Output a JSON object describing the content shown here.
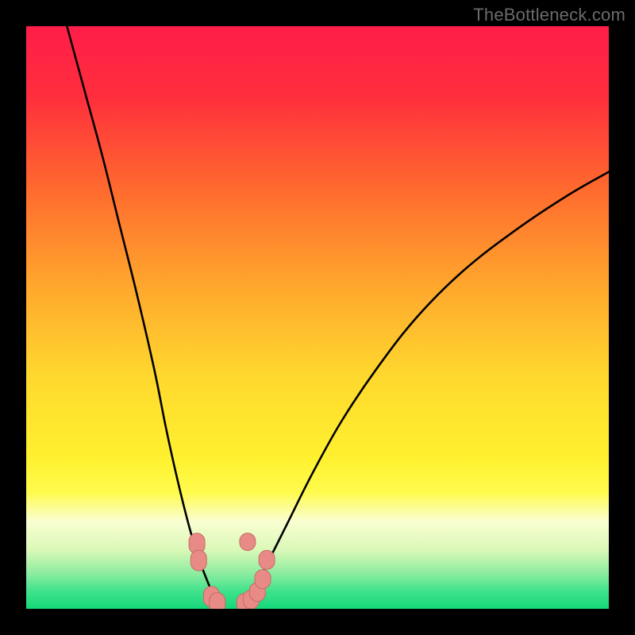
{
  "watermark": "TheBottleneck.com",
  "colors": {
    "gradient_stops": [
      {
        "offset": 0.0,
        "color": "#ff1d49"
      },
      {
        "offset": 0.12,
        "color": "#ff2e3d"
      },
      {
        "offset": 0.28,
        "color": "#ff6a2e"
      },
      {
        "offset": 0.44,
        "color": "#ffa52d"
      },
      {
        "offset": 0.6,
        "color": "#ffd82e"
      },
      {
        "offset": 0.74,
        "color": "#fff12f"
      },
      {
        "offset": 0.8,
        "color": "#fffb4d"
      },
      {
        "offset": 0.85,
        "color": "#fafed2"
      },
      {
        "offset": 0.9,
        "color": "#d9f8b7"
      },
      {
        "offset": 0.94,
        "color": "#8aec9f"
      },
      {
        "offset": 0.97,
        "color": "#3fe28c"
      },
      {
        "offset": 1.0,
        "color": "#16d87b"
      }
    ],
    "curve": "#000000",
    "markers_fill": "#e88b86",
    "markers_stroke": "#c96a64"
  },
  "chart_data": {
    "type": "line",
    "title": "",
    "xlabel": "",
    "ylabel": "",
    "xlim": [
      0,
      100
    ],
    "ylim": [
      0,
      100
    ],
    "series": [
      {
        "name": "left-arm",
        "x": [
          7,
          10,
          13,
          16,
          19,
          22,
          24,
          26,
          28,
          29.5,
          31,
          32.3,
          33.3
        ],
        "values": [
          100,
          89,
          78,
          66,
          54,
          41,
          31,
          22,
          14,
          9,
          5,
          2,
          0.5
        ]
      },
      {
        "name": "right-arm",
        "x": [
          37.3,
          38.5,
          40,
          42,
          45,
          49,
          54,
          60,
          67,
          75,
          84,
          93,
          100
        ],
        "values": [
          0.5,
          2,
          5,
          9,
          15,
          23,
          32,
          41,
          50,
          58,
          65,
          71,
          75
        ]
      }
    ],
    "markers": {
      "left_cluster": {
        "x": [
          29.3,
          29.6,
          31.8,
          32.8
        ],
        "y": [
          11.2,
          8.3,
          2.1,
          1.0
        ]
      },
      "right_cluster": {
        "x": [
          37.5,
          38.6,
          39.7,
          40.6,
          41.3
        ],
        "y": [
          1.0,
          1.6,
          2.9,
          5.1,
          8.4
        ]
      },
      "top_singles": {
        "x": [
          38.0
        ],
        "y": [
          11.5
        ]
      }
    }
  }
}
